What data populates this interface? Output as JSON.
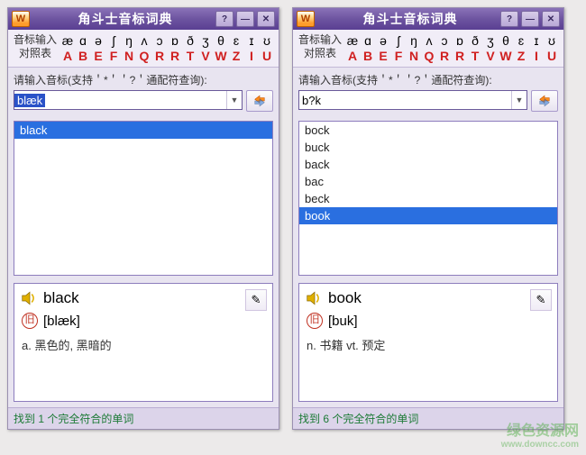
{
  "common": {
    "app_title": "角斗士音标词典",
    "ref_label1": "音标输入",
    "ref_label2": "对照表",
    "ipa_symbols": [
      "æ",
      "ɑ",
      "ə",
      "ʃ",
      "ŋ",
      "ʌ",
      "ɔ",
      "ɒ",
      "ð",
      "ʒ",
      "θ",
      "ɛ",
      "ɪ",
      "ʊ"
    ],
    "letter_symbols": [
      "A",
      "B",
      "E",
      "F",
      "N",
      "Q",
      "R",
      "R",
      "T",
      "V",
      "W",
      "Z",
      "I",
      "U"
    ],
    "prompt": "请输入音标(支持＇*＇＇?＇通配符查询):",
    "go_icon": "go-arrows-icon",
    "edit_icon": "✎",
    "ju_mark": "旧"
  },
  "left": {
    "search_value": "blæk",
    "search_selected": true,
    "results": [
      {
        "label": "black",
        "highlight": true
      }
    ],
    "headword": "black",
    "pron": "[blæk]",
    "definition": "a. 黑色的, 黑暗的",
    "status": "找到 1 个完全符合的单词"
  },
  "right": {
    "search_value": "b?k",
    "search_selected": false,
    "results": [
      {
        "label": "bock",
        "highlight": false
      },
      {
        "label": "buck",
        "highlight": false
      },
      {
        "label": "back",
        "highlight": false
      },
      {
        "label": "bac",
        "highlight": false
      },
      {
        "label": "beck",
        "highlight": false
      },
      {
        "label": "book",
        "highlight": true
      }
    ],
    "headword": "book",
    "pron": "[buk]",
    "definition": "n. 书籍  vt. 预定",
    "status": "找到 6 个完全符合的单词"
  },
  "watermark": {
    "line1": "绿色资源网",
    "line2": "www.downcc.com"
  }
}
